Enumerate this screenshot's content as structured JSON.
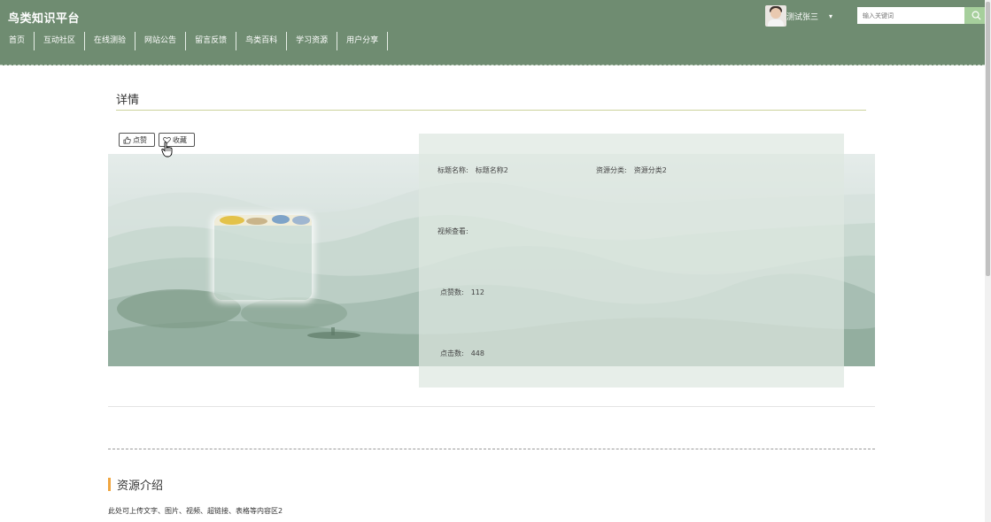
{
  "header": {
    "brand": "鸟类知识平台",
    "nav": [
      "首页",
      "互动社区",
      "在线测验",
      "网站公告",
      "留言反馈",
      "鸟类百科",
      "学习资源",
      "用户分享"
    ],
    "username": "测试张三",
    "user_caret": "▾",
    "search_placeholder": "输入关键词"
  },
  "detail": {
    "title": "详情",
    "like_label": "点赞",
    "fav_label": "收藏",
    "fields": {
      "title_label": "标题名称:",
      "title_value": "标题名称2",
      "category_label": "资源分类:",
      "category_value": "资源分类2",
      "video_label": "视频查看:",
      "likes_label": "点赞数:",
      "likes_value": "112",
      "clicks_label": "点击数:",
      "clicks_value": "448"
    }
  },
  "intro": {
    "title": "资源介绍",
    "body": "此处可上传文字、图片、视频、超链接、表格等内容区2"
  },
  "colors": {
    "header_bg": "#6f8c71",
    "accent_bar": "#f0a640",
    "search_button": "#a6cf9c"
  }
}
